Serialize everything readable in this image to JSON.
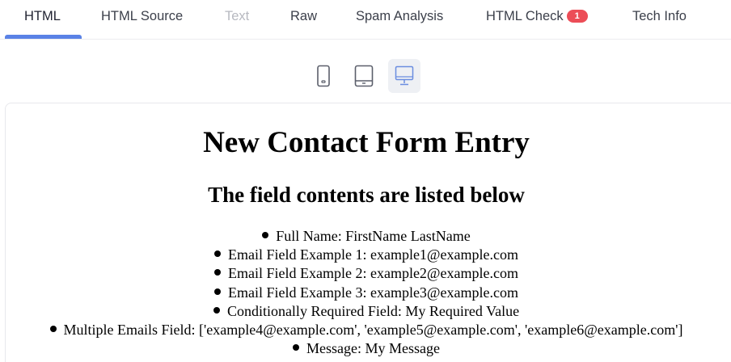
{
  "tabs": [
    {
      "label": "HTML",
      "state": "active"
    },
    {
      "label": "HTML Source",
      "state": "normal"
    },
    {
      "label": "Text",
      "state": "disabled"
    },
    {
      "label": "Raw",
      "state": "normal"
    },
    {
      "label": "Spam Analysis",
      "state": "normal"
    },
    {
      "label": "HTML Check",
      "state": "normal",
      "badge": "1"
    },
    {
      "label": "Tech Info",
      "state": "normal"
    }
  ],
  "device_toolbar": {
    "buttons": [
      {
        "icon": "mobile-icon",
        "active": false
      },
      {
        "icon": "tablet-icon",
        "active": false
      },
      {
        "icon": "desktop-icon",
        "active": true
      }
    ]
  },
  "colors": {
    "accent": "#5a82e6",
    "badge": "#ec4d57",
    "disabled_text": "#b7b9c0"
  },
  "email": {
    "heading": "New Contact Form Entry",
    "subheading": "The field contents are listed below",
    "fields": [
      "Full Name: FirstName LastName",
      "Email Field Example 1: example1@example.com",
      "Email Field Example 2: example2@example.com",
      "Email Field Example 3: example3@example.com",
      "Conditionally Required Field: My Required Value",
      "Multiple Emails Field: ['example4@example.com', 'example5@example.com', 'example6@example.com']",
      "Message: My Message"
    ]
  }
}
